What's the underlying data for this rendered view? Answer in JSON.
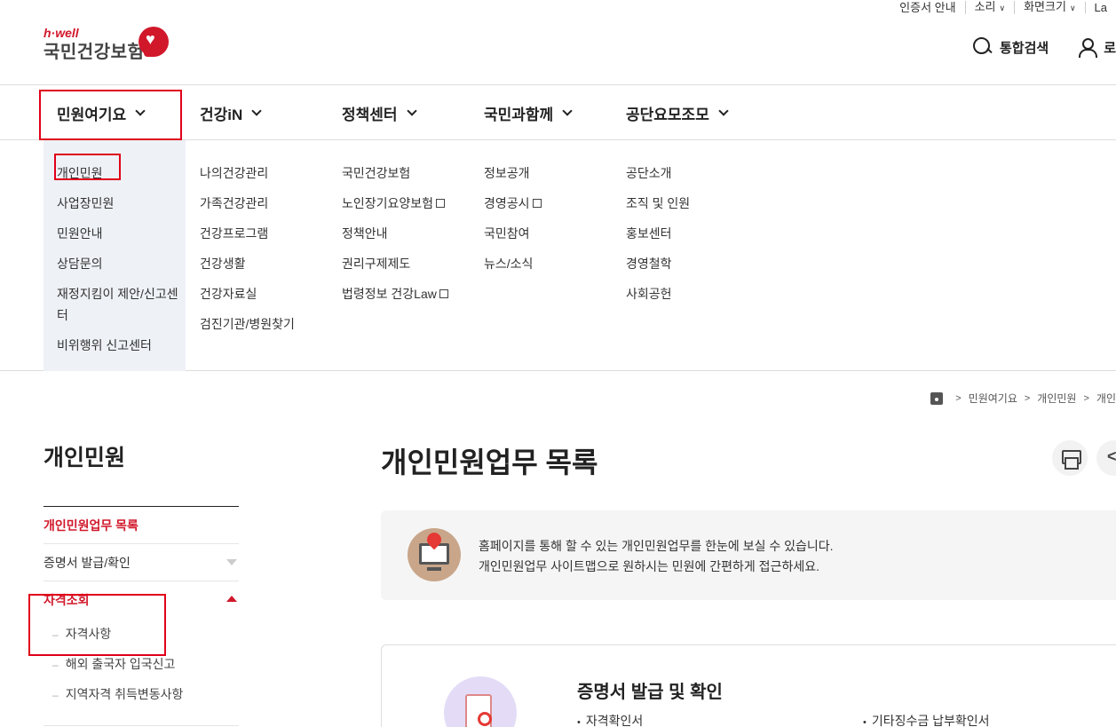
{
  "utility": {
    "cert": "인증서 안내",
    "sound": "소리",
    "size": "화면크기",
    "lang": "La"
  },
  "logo": {
    "brand": "h·well",
    "name": "국민건강보험"
  },
  "header": {
    "search": "통합검색",
    "login": "로"
  },
  "gnb": [
    {
      "label": "민원여기요"
    },
    {
      "label": "건강iN"
    },
    {
      "label": "정책센터"
    },
    {
      "label": "국민과함께"
    },
    {
      "label": "공단요모조모"
    }
  ],
  "dropdown": {
    "col1": [
      "개인민원",
      "사업장민원",
      "민원안내",
      "상담문의",
      "재정지킴이 제안/신고센터",
      "비위행위 신고센터"
    ],
    "col2": [
      "나의건강관리",
      "가족건강관리",
      "건강프로그램",
      "건강생활",
      "건강자료실",
      "검진기관/병원찾기"
    ],
    "col3": [
      "국민건강보험",
      "노인장기요양보험",
      "정책안내",
      "권리구제제도",
      "법령정보 건강Law"
    ],
    "col4": [
      "정보공개",
      "경영공시",
      "국민참여",
      "뉴스/소식"
    ],
    "col5": [
      "공단소개",
      "조직 및 인원",
      "홍보센터",
      "경영철학",
      "사회공헌"
    ]
  },
  "breadcrumb": [
    "민원여기요",
    "개인민원",
    "개인"
  ],
  "side": {
    "title": "개인민원",
    "items": [
      {
        "label": "개인민원업무 목록"
      },
      {
        "label": "증명서 발급/확인"
      },
      {
        "label": "자격조회"
      }
    ],
    "subs": [
      "자격사항",
      "해외 출국자 입국신고",
      "지역자격 취득변동사항"
    ]
  },
  "main": {
    "title": "개인민원업무 목록",
    "intro1": "홈페이지를 통해 할 수 있는 개인민원업무를 한눈에 보실 수 있습니다.",
    "intro2": "개인민원업무 사이트맵으로 원하시는 민원에 간편하게 접근하세요.",
    "card_title": "증명서 발급 및 확인",
    "card_item1": "자격확인서",
    "card_item2": "기타징수금 납부확인서"
  },
  "colors": {
    "accent": "#d1182b",
    "highlight_box": "#e0001a",
    "submenu_bg": "#eef1f6"
  }
}
